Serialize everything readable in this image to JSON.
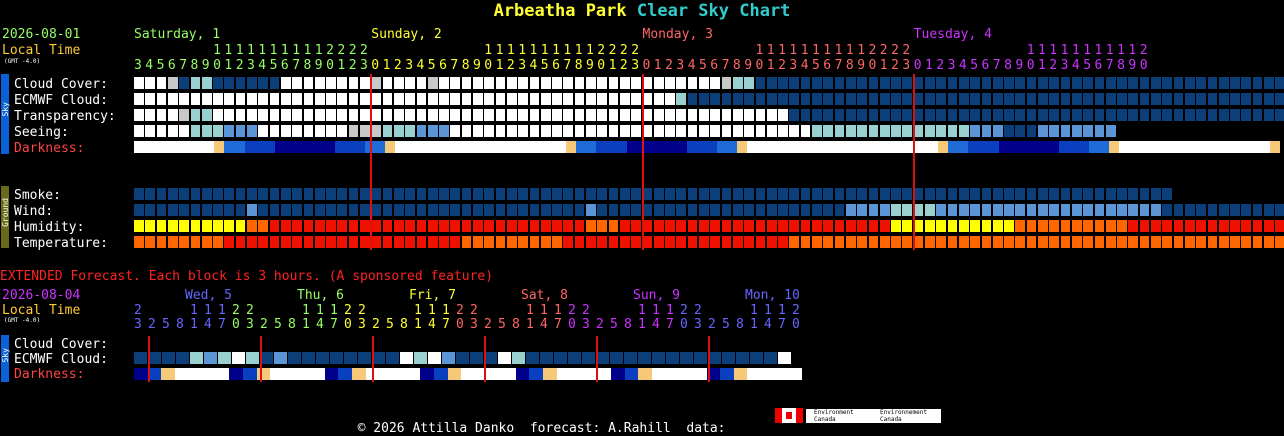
{
  "title": {
    "park": "Arbeatha Park",
    "rest": "Clear Sky Chart",
    "park_color": "#ffff33",
    "rest_color": "#33cccc"
  },
  "main": {
    "date": "2026-08-01",
    "local_time": "Local Time",
    "gmt": "(GMT -4.0)",
    "days": [
      {
        "label": "Saturday, 1",
        "color": "#99ff66"
      },
      {
        "label": "Sunday, 2",
        "color": "#ffff33"
      },
      {
        "label": "Monday, 3",
        "color": "#ff6666"
      },
      {
        "label": "Tuesday, 4",
        "color": "#cc33ff"
      }
    ],
    "hours": [
      3,
      4,
      5,
      6,
      7,
      8,
      9,
      10,
      11,
      12,
      13,
      14,
      15,
      16,
      17,
      18,
      19,
      20,
      21,
      22,
      23,
      0,
      1,
      2,
      3,
      4,
      5,
      6,
      7,
      8,
      9,
      10,
      11,
      12,
      13,
      14,
      15,
      16,
      17,
      18,
      19,
      20,
      21,
      22,
      23,
      0,
      1,
      2,
      3,
      4,
      5,
      6,
      7,
      8,
      9,
      10,
      11,
      12,
      13,
      14,
      15,
      16,
      17,
      18,
      19,
      20,
      21,
      22,
      23,
      0,
      1,
      2,
      3,
      4,
      5,
      6,
      7,
      8,
      9,
      10,
      11,
      12,
      13,
      14,
      15,
      16,
      17,
      18,
      19,
      20
    ],
    "sky_rows": [
      {
        "label": "Cloud Cover:",
        "cells": "wwwgbLLbbbbbbwwwwwwwwgwwwwgwwwwwwwwwwwwwwwwwwwwwwwwwgLLbbbbbbbbbbbbbbbbbbbbbbbbbbbbbbbbbbbbbbbbbbbbbbbbbbb"
      },
      {
        "label": "ECMWF Cloud:",
        "cells": "wwwwwwwwwwwwwwwwwwwwwwwwwwwwwwwwwwwwwwwwwwwwwwwwLbbbbbbbbbbbbbbbbbbbbbbbbbbbbbbbbbbbbbbbbbbbbbbbbbbbbbbbbbbbbb"
      },
      {
        "label": "Transparency:",
        "cells": "wwwwgLLwwwwwwwwwwwwwwwwwwwwwwwwwwwwwwwwwwwwwwwwwwwwwwwwwwwbbbbbbbbbbbbbbbbbbbbbbbbbbbbbbbbbbbbbbbbbbbbbbbbbbb"
      },
      {
        "label": "Seeing:",
        "cells": "wwwwwLLLmmmwwwwwwwwgggLLLmmmwwwwwwwwwwwwwwwwwwwwwwwwwwwwwwwwLLLLLLLLLLLLLLmmmbbbmmmmmmm"
      }
    ],
    "darkness_label": "Darkness:",
    "darkness": "wwwwwwwwyddDDDNNNNNNDDDddywwwwwwwwwwwwwwwwwyddDDDNNNNNNDDDddywwwwwwwwwwwwwwwwwwwyddDDDNNNNNNDDDddywwwwwwwwwwwwwwwy",
    "ground_rows": [
      {
        "label": "Smoke:",
        "cells": "bbbbbbbbbbbbbbbbbbbbbbbbbbbbbbbbbbbbbbbbbbbbbbbbbbbbbbbbbbbbbbbbbbbbbbbbbbbbbbbbbbbbbbbbbbbb"
      },
      {
        "label": "Wind:",
        "cells": "bbbbbbbbbbmbbbbbbbbbbbbbbbbbbbbbbbbbbbbbmbbbbbbbbbbbbbbbbbbbbbbmmmmLLLLmmmmmmmmmmmmmmmmmmmmbbbbbbbbbbbbbbbbbbbbbbbb"
      },
      {
        "label": "Humidity:",
        "cells": "YYYYYYYYYYOORRRRRRRRRRRRRRRRRRRRRRRRRRRROOORRRRRRRRRRRRRRRRRRRRRRRRYYYYYYYYYYYOOOOOOOOOORRRRRRRRRRRRRRRROOYYGGTTGGTT"
      },
      {
        "label": "Temperature:",
        "cells": "OOOOOOOORRRRRRRRRRRRRRRRRRRRROOOOOOOOORRRRRRRRRRRRRRRRRRRROOOOOOOOOOOOOOOOOOOOOOOOOOOOOOOOOOOOOOOOOOOOYYOOOOOOOOOO"
      }
    ],
    "sky_side": "Sky",
    "ground_side": "Ground"
  },
  "extended": {
    "notice": "EXTENDED Forecast. Each block is 3 hours. (A sponsored feature)",
    "date": "2026-08-04",
    "local_time": "Local Time",
    "gmt": "(GMT -4.0)",
    "days": [
      {
        "label": "Wed, 5",
        "color": "#6666ff"
      },
      {
        "label": "Thu, 6",
        "color": "#99ff66"
      },
      {
        "label": "Fri, 7",
        "color": "#ffff33"
      },
      {
        "label": "Sat, 8",
        "color": "#ff6666"
      },
      {
        "label": "Sun, 9",
        "color": "#cc33ff"
      },
      {
        "label": "Mon, 10",
        "color": "#6666ff"
      }
    ],
    "hours": [
      23,
      2,
      5,
      8,
      11,
      14,
      17,
      20,
      23,
      2,
      5,
      8,
      11,
      14,
      17,
      20,
      23,
      2,
      5,
      8,
      11,
      14,
      17,
      20,
      23,
      2,
      5,
      8,
      11,
      14,
      17,
      20,
      23,
      2,
      5,
      8,
      11,
      14,
      17,
      20,
      23,
      2,
      5,
      8,
      11,
      14,
      17,
      20
    ],
    "sky_rows": [
      {
        "label": "Cloud Cover:",
        "cells": ""
      },
      {
        "label": "ECMWF Cloud:",
        "cells": "bbbbLmLwLbmbbbbbbbbwLwmbbbwLbbbbbbbbbbbbbbbbbbw"
      }
    ],
    "darkness_label": "Darkness:",
    "darkness": "NDywwwwNDywwwwNDywwwwNDywwwwNDywwwwNDywwwwNDywwww"
  },
  "footer": {
    "text": "© 2026 Attilla Danko  forecast: A.Rahill  data:",
    "logo1": "Environment Canada",
    "logo2": "Environnement Canada"
  },
  "colors": {
    "w": "#ffffff",
    "g": "#c8c8c8",
    "L": "#99d1d1",
    "m": "#5b95d5",
    "b": "#0c3f7a",
    "y": "#f6c978",
    "d": "#1f6bd8",
    "D": "#0a3fbf",
    "N": "#00008a",
    "Y": "#ffff00",
    "O": "#ff6600",
    "R": "#ee1100",
    "G": "#66ff99",
    "T": "#00ffff",
    "label_sky": "#ffffff",
    "darkness_label": "#ff4444",
    "side_sky": "#0a62d8",
    "side_ground": "#6a6a1a",
    "midnight": "#dd1111",
    "extended_notice": "#ff2222"
  }
}
